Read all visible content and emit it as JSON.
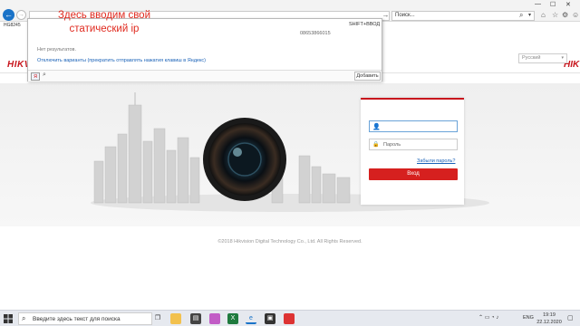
{
  "annotation": {
    "line1": "Здесь вводим свой",
    "line2": "статический ip"
  },
  "browser": {
    "tab_title": "HG8245",
    "search_placeholder": "Поиск...",
    "icons": [
      "back-arrow-icon",
      "forward-arrow-icon",
      "go-arrow-icon",
      "search-icon",
      "home-icon",
      "star-icon",
      "gear-icon",
      "smiley-icon"
    ]
  },
  "address_dropdown": {
    "shortcut": "SHIFT+ВВОД",
    "number": "08653866015",
    "no_results": "Нет результатов.",
    "disable_suggestions": "Отключить варианты (прекратить отправлять нажатия клавиш в Яндекс)",
    "add_label": "Добавить",
    "engine_icon": "Я"
  },
  "page": {
    "logo": "HIKVISION",
    "language": "Русский",
    "login": {
      "password_placeholder": "Пароль",
      "forgot": "Забыли пароль?",
      "submit": "Вход"
    },
    "copyright": "©2018 Hikvision Digital Technology Co., Ltd. All Rights Reserved."
  },
  "taskbar": {
    "search_text": "Введите здесь текст для поиска",
    "lang": "ENG",
    "time": "19:19",
    "date": "22.12.2020"
  },
  "colors": {
    "brand": "#c8161d",
    "annotation": "#e02a1f",
    "link": "#1a62b8",
    "button": "#d6201f"
  }
}
